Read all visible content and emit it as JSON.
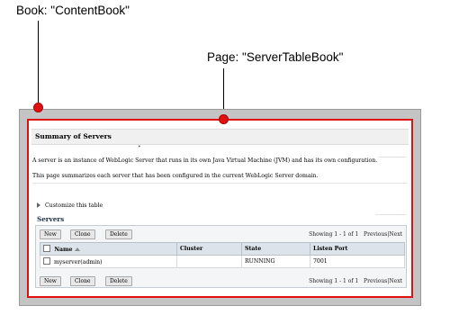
{
  "annotations": {
    "book_label": "Book: \"ContentBook\"",
    "page_label": "Page: \"ServerTableBook\""
  },
  "summary": {
    "title": "Summary of Servers",
    "mark": "•",
    "description_line1": "A server is an instance of WebLogic Server that runs in its own Java Virtual Machine (JVM) and has its own configuration.",
    "description_line2": "This page summarizes each server that has been configured in the current WebLogic Server domain."
  },
  "customize_link": "Customize this table",
  "servers": {
    "label": "Servers",
    "buttons": {
      "new": "New",
      "clone": "Clone",
      "delete": "Delete"
    },
    "paging": {
      "showing": "Showing 1 - 1 of 1",
      "previous": "Previous",
      "separator": "|",
      "next": "Next"
    },
    "columns": {
      "name": "Name",
      "cluster": "Cluster",
      "state": "State",
      "listen_port": "Listen Port"
    },
    "rows": [
      {
        "name": "myserver(admin)",
        "cluster": "",
        "state": "RUNNING",
        "listen_port": "7001"
      }
    ]
  },
  "colors": {
    "callout_dot": "#e01010",
    "book_bg": "#c4c4c4",
    "header_bg": "#dde3ea"
  }
}
